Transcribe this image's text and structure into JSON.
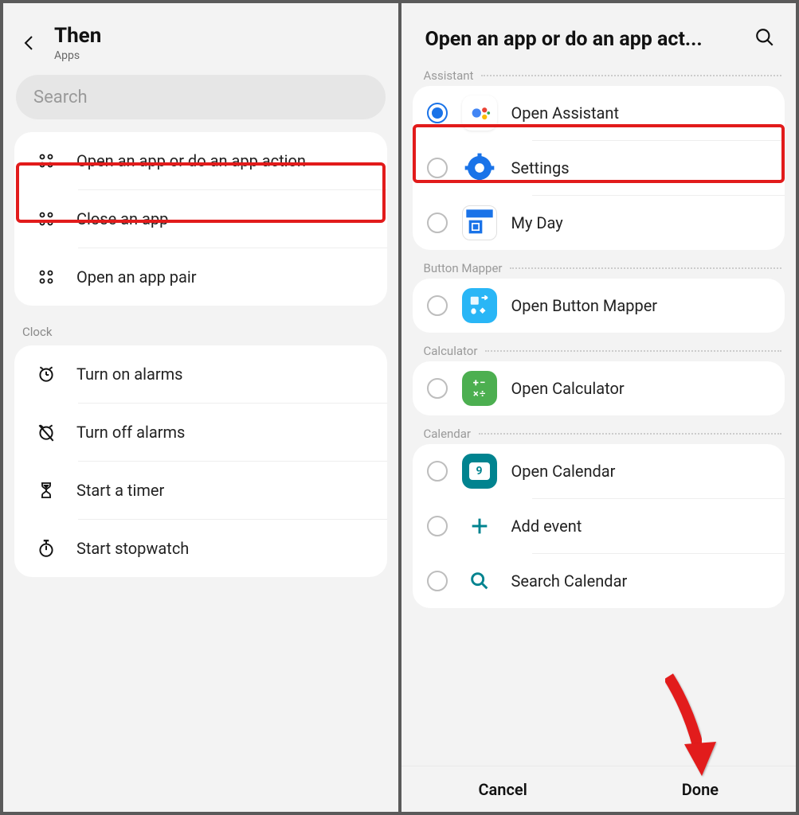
{
  "left": {
    "title": "Then",
    "subtitle": "Apps",
    "search_placeholder": "Search",
    "actions": [
      {
        "label": "Open an app or do an app action"
      },
      {
        "label": "Close an app"
      },
      {
        "label": "Open an app pair"
      }
    ],
    "sections": [
      {
        "name": "Clock",
        "items": [
          {
            "label": "Turn on alarms",
            "icon": "alarm-on-icon"
          },
          {
            "label": "Turn off alarms",
            "icon": "alarm-off-icon"
          },
          {
            "label": "Start a timer",
            "icon": "hourglass-icon"
          },
          {
            "label": "Start stopwatch",
            "icon": "stopwatch-icon"
          }
        ]
      }
    ]
  },
  "right": {
    "title": "Open an app or do an app act...",
    "groups": [
      {
        "name": "Assistant",
        "items": [
          {
            "label": "Open Assistant",
            "icon": "assistant-app-icon",
            "selected": true
          },
          {
            "label": "Settings",
            "icon": "settings-app-icon",
            "selected": false
          },
          {
            "label": "My Day",
            "icon": "myday-app-icon",
            "selected": false
          }
        ]
      },
      {
        "name": "Button Mapper",
        "items": [
          {
            "label": "Open Button Mapper",
            "icon": "button-mapper-app-icon",
            "selected": false
          }
        ]
      },
      {
        "name": "Calculator",
        "items": [
          {
            "label": "Open Calculator",
            "icon": "calculator-app-icon",
            "selected": false
          }
        ]
      },
      {
        "name": "Calendar",
        "items": [
          {
            "label": "Open Calendar",
            "icon": "calendar-app-icon",
            "selected": false
          },
          {
            "label": "Add event",
            "icon": "plus-icon",
            "selected": false
          },
          {
            "label": "Search Calendar",
            "icon": "search-calendar-icon",
            "selected": false
          }
        ]
      }
    ],
    "buttons": {
      "cancel": "Cancel",
      "done": "Done"
    }
  }
}
